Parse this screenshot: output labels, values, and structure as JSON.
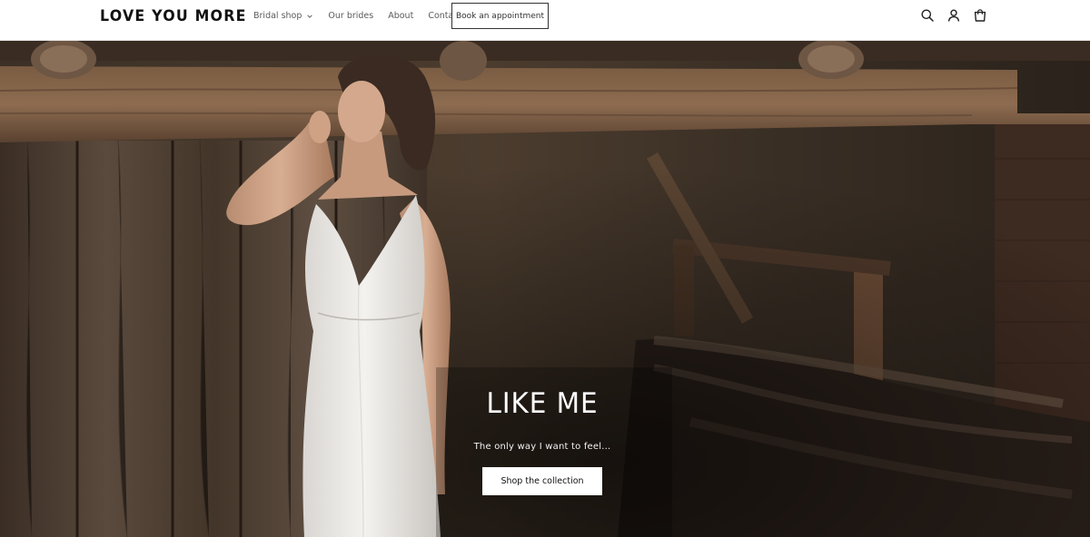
{
  "header": {
    "logo": "LOVE YOU MORE",
    "nav": [
      {
        "label": "Bridal shop",
        "has_dropdown": true
      },
      {
        "label": "Our brides",
        "has_dropdown": false
      },
      {
        "label": "About",
        "has_dropdown": false
      },
      {
        "label": "Contact",
        "has_dropdown": false
      }
    ],
    "appointment_label": "Book an appointment",
    "icons": [
      "search-icon",
      "account-icon",
      "cart-icon"
    ]
  },
  "hero": {
    "title": "LIKE ME",
    "subtitle": "The only way I want to feel...",
    "button_label": "Shop the collection"
  },
  "colors": {
    "header_bg": "#ffffff",
    "text_dark": "#121212",
    "nav_text": "#5b5b5b",
    "hero_text": "#ffffff",
    "button_bg": "#ffffff"
  }
}
